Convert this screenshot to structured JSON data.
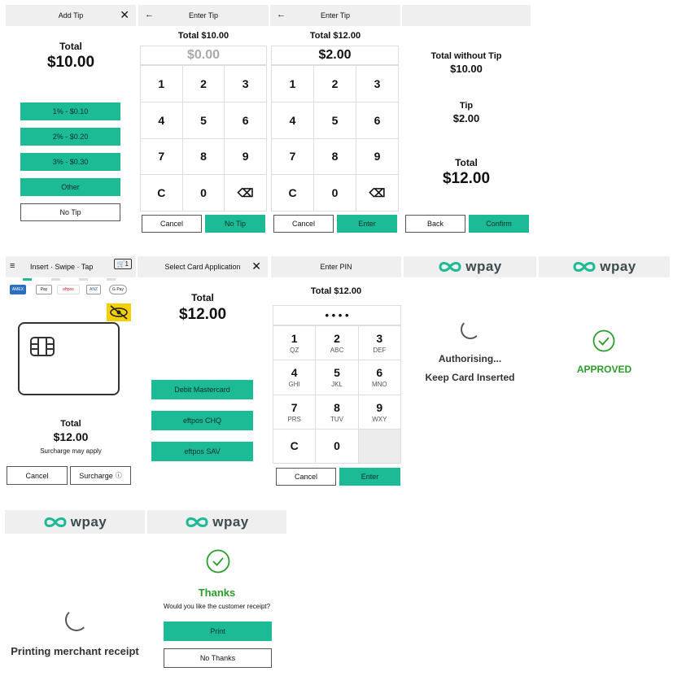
{
  "add_tip": {
    "header": "Add Tip",
    "total_label": "Total",
    "total_value": "$10.00",
    "options": [
      "1% - $0.10",
      "2% - $0.20",
      "3% - $0.30",
      "Other"
    ],
    "no_tip": "No Tip"
  },
  "enter_tip_1": {
    "header": "Enter Tip",
    "total": "Total $10.00",
    "display": "$0.00",
    "keys": [
      "1",
      "2",
      "3",
      "4",
      "5",
      "6",
      "7",
      "8",
      "9",
      "C",
      "0",
      "⌫"
    ],
    "cancel": "Cancel",
    "confirm": "No Tip"
  },
  "enter_tip_2": {
    "header": "Enter Tip",
    "total": "Total $12.00",
    "display": "$2.00",
    "keys": [
      "1",
      "2",
      "3",
      "4",
      "5",
      "6",
      "7",
      "8",
      "9",
      "C",
      "0",
      "⌫"
    ],
    "cancel": "Cancel",
    "confirm": "Enter"
  },
  "summary": {
    "without_tip_label": "Total without Tip",
    "without_tip_value": "$10.00",
    "tip_label": "Tip",
    "tip_value": "$2.00",
    "total_label": "Total",
    "total_value": "$12.00",
    "back": "Back",
    "confirm": "Confirm"
  },
  "present_card": {
    "header": "Insert · Swipe · Tap",
    "cart_count": "1",
    "icons": [
      "AMEX",
      "Pay",
      "eftpos",
      "ANZ",
      "G Pay"
    ],
    "total_label": "Total",
    "total_value": "$12.00",
    "surcharge_note": "Surcharge may apply",
    "cancel": "Cancel",
    "surcharge": "Surcharge"
  },
  "select_app": {
    "header": "Select Card Application",
    "total_label": "Total",
    "total_value": "$12.00",
    "apps": [
      "Debit Mastercard",
      "eftpos CHQ",
      "eftpos SAV"
    ]
  },
  "enter_pin": {
    "header": "Enter PIN",
    "total": "Total $12.00",
    "pin": "• • • •",
    "keys": [
      {
        "n": "1",
        "s": "QZ"
      },
      {
        "n": "2",
        "s": "ABC"
      },
      {
        "n": "3",
        "s": "DEF"
      },
      {
        "n": "4",
        "s": "GHI"
      },
      {
        "n": "5",
        "s": "JKL"
      },
      {
        "n": "6",
        "s": "MNO"
      },
      {
        "n": "7",
        "s": "PRS"
      },
      {
        "n": "8",
        "s": "TUV"
      },
      {
        "n": "9",
        "s": "WXY"
      },
      {
        "n": "C",
        "s": ""
      },
      {
        "n": "0",
        "s": ""
      },
      {
        "n": "",
        "s": ""
      }
    ],
    "cancel": "Cancel",
    "enter": "Enter"
  },
  "brand": {
    "name": "wpay",
    "color": "#1dbb95"
  },
  "authorising": {
    "line1": "Authorising...",
    "line2": "Keep Card Inserted"
  },
  "approved": {
    "status": "APPROVED",
    "color": "#2a9d2a"
  },
  "printing": {
    "message": "Printing merchant receipt"
  },
  "thanks": {
    "title": "Thanks",
    "question": "Would you like the customer receipt?",
    "print": "Print",
    "no_thanks": "No Thanks"
  }
}
